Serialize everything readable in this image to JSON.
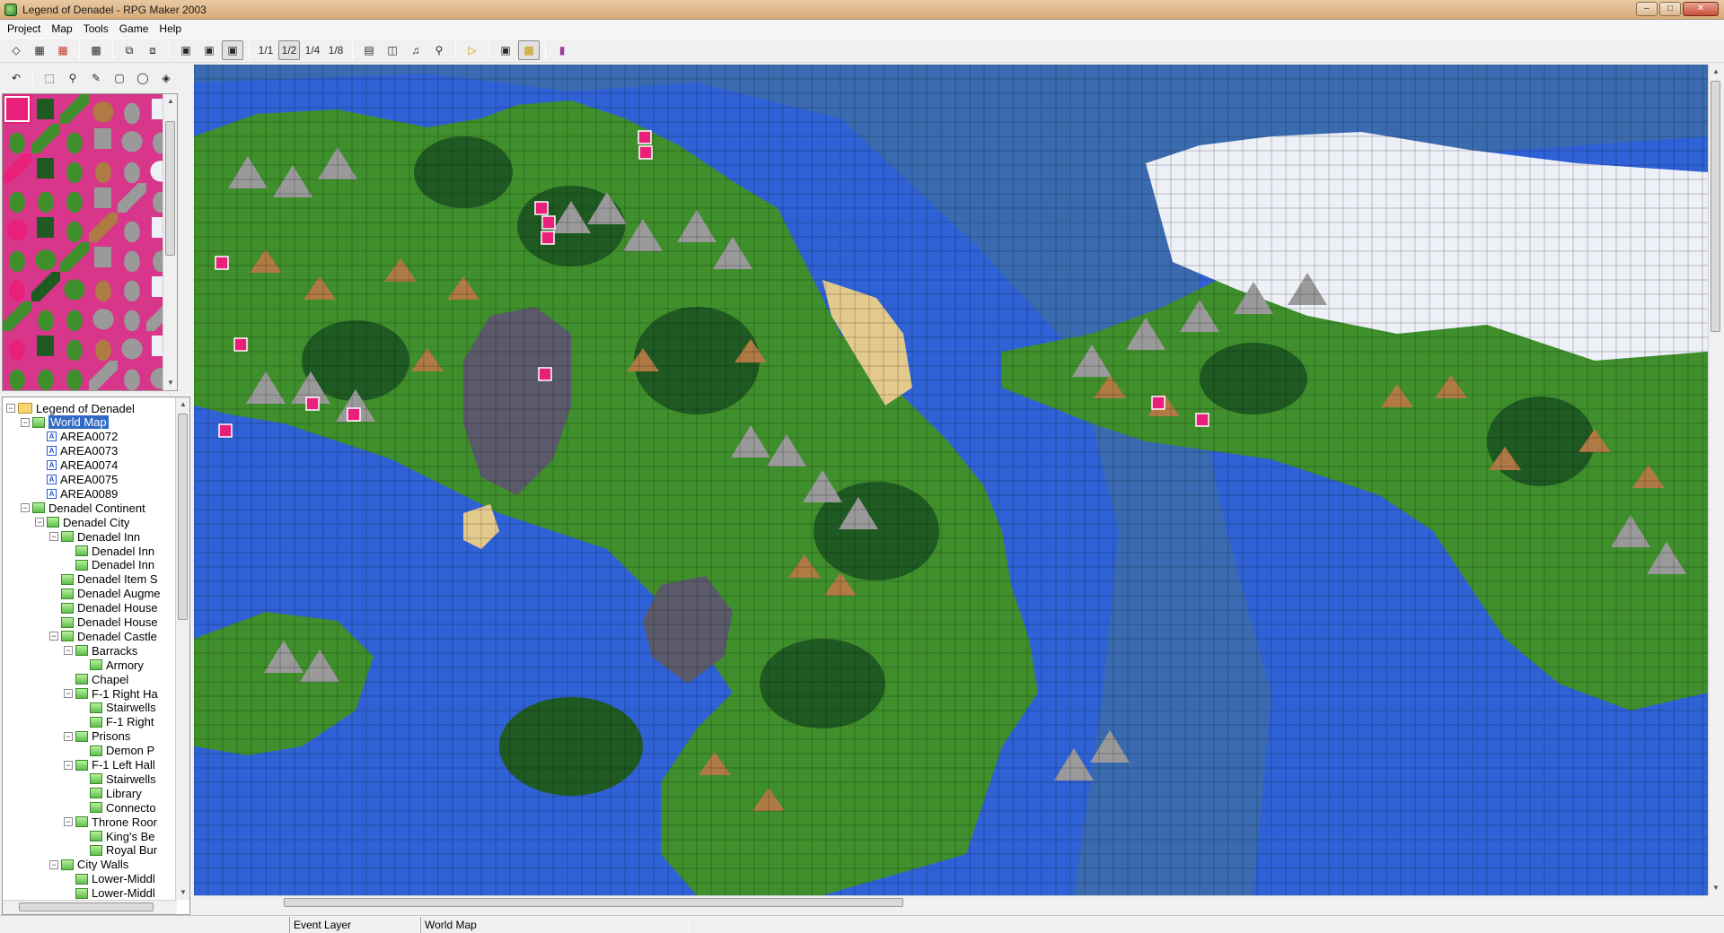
{
  "window": {
    "title": "Legend of Denadel - RPG Maker 2003",
    "controls": [
      "minimize-icon",
      "maximize-icon",
      "close-icon"
    ]
  },
  "menu": {
    "items": [
      "Project",
      "Map",
      "Tools",
      "Game",
      "Help"
    ]
  },
  "toolbar": {
    "buttons": [
      "new-project-icon",
      "open-project-icon",
      "close-project-icon",
      "save-icon",
      "revert-icon",
      "import-icon",
      "lower-layer-icon",
      "upper-layer-icon",
      "event-layer-icon"
    ],
    "zoom_labels": [
      "1/1",
      "1/2",
      "1/4",
      "1/8"
    ],
    "tools": [
      "database-icon",
      "resource-manager-icon",
      "sound-test-icon",
      "search-events-icon",
      "playtest-icon",
      "fullscreen-icon",
      "show-title-icon",
      "help-book-icon"
    ]
  },
  "draw_tools": [
    "undo-icon",
    "select-icon",
    "zoom-icon",
    "pencil-icon",
    "rectangle-icon",
    "circle-icon",
    "fill-icon"
  ],
  "tree": {
    "items": [
      {
        "label": "Legend of Denadel",
        "type": "folder",
        "level": 0,
        "expanded": true
      },
      {
        "label": "World Map",
        "type": "map",
        "level": 1,
        "expanded": true,
        "selected": true
      },
      {
        "label": "AREA0072",
        "type": "area",
        "level": 2
      },
      {
        "label": "AREA0073",
        "type": "area",
        "level": 2
      },
      {
        "label": "AREA0074",
        "type": "area",
        "level": 2
      },
      {
        "label": "AREA0075",
        "type": "area",
        "level": 2
      },
      {
        "label": "AREA0089",
        "type": "area",
        "level": 2
      },
      {
        "label": "Denadel Continent",
        "type": "map",
        "level": 1,
        "expanded": true
      },
      {
        "label": "Denadel City",
        "type": "map",
        "level": 2,
        "expanded": true
      },
      {
        "label": "Denadel Inn",
        "type": "map",
        "level": 3,
        "expanded": true
      },
      {
        "label": "Denadel Inn",
        "type": "map",
        "level": 4
      },
      {
        "label": "Denadel Inn",
        "type": "map",
        "level": 4
      },
      {
        "label": "Denadel Item S",
        "type": "map",
        "level": 3
      },
      {
        "label": "Denadel Augme",
        "type": "map",
        "level": 3
      },
      {
        "label": "Denadel House",
        "type": "map",
        "level": 3
      },
      {
        "label": "Denadel House",
        "type": "map",
        "level": 3
      },
      {
        "label": "Denadel Castle",
        "type": "map",
        "level": 3,
        "expanded": true
      },
      {
        "label": "Barracks",
        "type": "map",
        "level": 4,
        "expanded": true
      },
      {
        "label": "Armory",
        "type": "map",
        "level": 5
      },
      {
        "label": "Chapel",
        "type": "map",
        "level": 4
      },
      {
        "label": "F-1 Right Ha",
        "type": "map",
        "level": 4,
        "expanded": true
      },
      {
        "label": "Stairwells",
        "type": "map",
        "level": 5
      },
      {
        "label": "F-1 Right",
        "type": "map",
        "level": 5
      },
      {
        "label": "Prisons",
        "type": "map",
        "level": 4,
        "expanded": true
      },
      {
        "label": "Demon P",
        "type": "map",
        "level": 5
      },
      {
        "label": "F-1 Left Hall",
        "type": "map",
        "level": 4,
        "expanded": true
      },
      {
        "label": "Stairwells",
        "type": "map",
        "level": 5
      },
      {
        "label": "Library",
        "type": "map",
        "level": 5
      },
      {
        "label": "Connecto",
        "type": "map",
        "level": 5
      },
      {
        "label": "Throne Roor",
        "type": "map",
        "level": 4,
        "expanded": true
      },
      {
        "label": "King's Be",
        "type": "map",
        "level": 5
      },
      {
        "label": "Royal Bur",
        "type": "map",
        "level": 5
      },
      {
        "label": "City Walls",
        "type": "map",
        "level": 3,
        "expanded": true
      },
      {
        "label": "Lower-Middl",
        "type": "map",
        "level": 4
      },
      {
        "label": "Lower-Middl",
        "type": "map",
        "level": 4
      }
    ]
  },
  "statusbar": {
    "layer": "Event Layer",
    "map_name": "World Map"
  },
  "colors": {
    "deep_sea": "#3a6bb0",
    "shallow_sea": "#2f62d6",
    "grass": "#3f8f2c",
    "forest": "#1f5a22",
    "mountain": "#9a9a9a",
    "dirt_hill": "#b07a44",
    "sand": "#e3c98c",
    "snow": "#eef0f8",
    "swamp": "#5a5a6a",
    "event_marker": "#e8207a",
    "tile_bg": "#d8368a"
  }
}
